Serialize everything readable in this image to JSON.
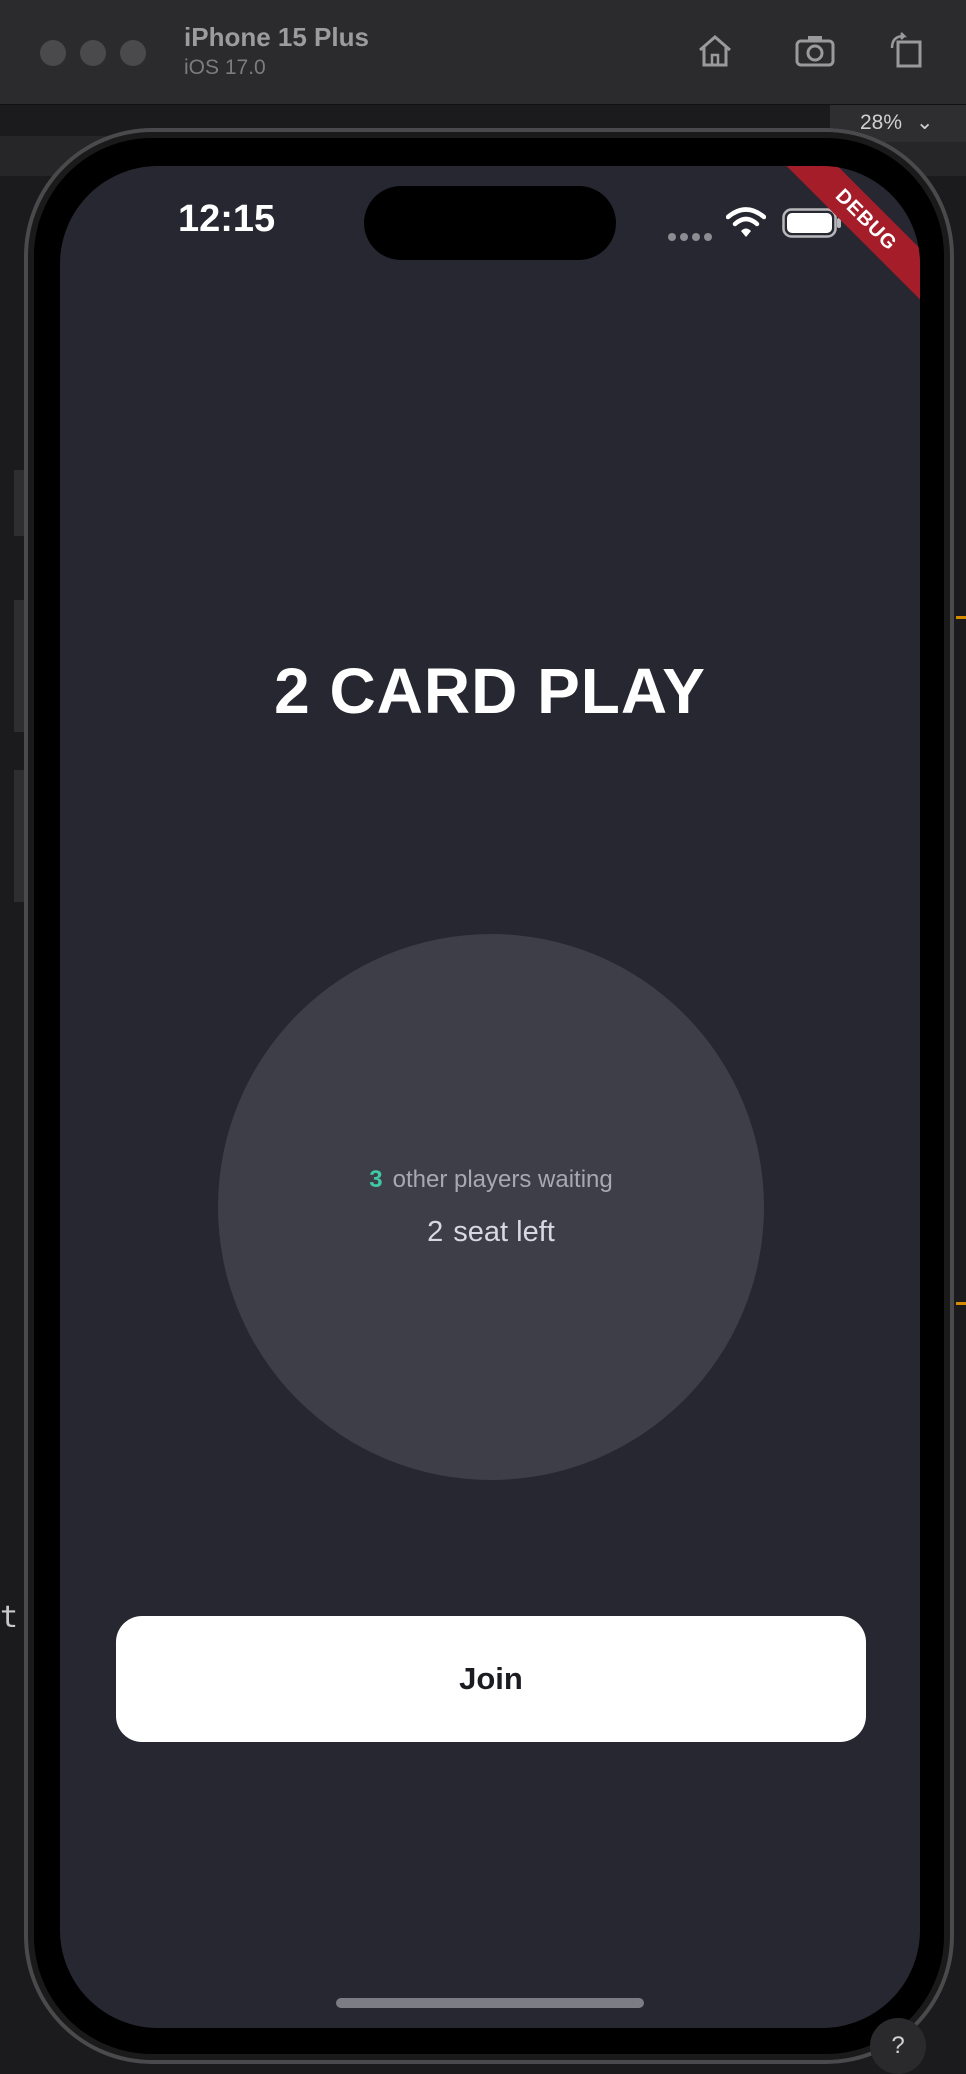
{
  "simulator": {
    "device_name": "iPhone 15 Plus",
    "os_version": "iOS 17.0",
    "zoom_level": "28%",
    "zoom_chevron_icon": "chevron-down-icon",
    "toolbar_icons": [
      "home-icon",
      "screenshot-icon",
      "rotate-icon"
    ],
    "edge_text": "t|",
    "help_badge": "?"
  },
  "status_bar": {
    "time": "12:15",
    "icons": [
      "cellular-signal-icon",
      "wifi-icon",
      "battery-icon"
    ]
  },
  "debug_banner": {
    "label": "DEBUG",
    "color": "#a61d2a"
  },
  "app": {
    "title": "2 CARD PLAY",
    "waiting": {
      "count": "3",
      "label": "other players waiting",
      "count_color": "#3ec8a6"
    },
    "seats": {
      "count": "2",
      "label": "seat left"
    },
    "join_button": "Join",
    "background_color": "#272731",
    "circle_color": "#3e3e48"
  }
}
